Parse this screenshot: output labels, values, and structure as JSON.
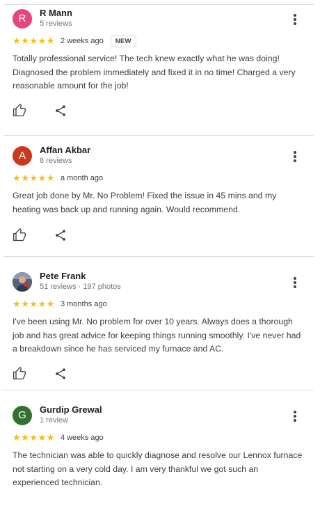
{
  "colors": {
    "star": "#fbbc04",
    "separator": "#dadce0",
    "avatar_r_mann": "#e8457a",
    "avatar_affan": "#c83b1d",
    "avatar_gurdip": "#34702f"
  },
  "icons": {
    "star": "★",
    "like": "thumb-up-icon",
    "share": "share-icon",
    "more": "more-vert-icon"
  },
  "reviews": [
    {
      "initial": "R",
      "name": "R Mann",
      "meta": "5 reviews",
      "rating": 5,
      "time": "2 weeks ago",
      "badge": "NEW",
      "text": "Totally professional service! The tech knew exactly what he was doing! Diagnosed the problem immediately and fixed it in no time! Charged a very reasonable amount for the job!"
    },
    {
      "initial": "A",
      "name": "Affan Akbar",
      "meta": "8 reviews",
      "rating": 5,
      "time": "a month ago",
      "text": "Great job done by Mr. No Problem! Fixed the issue in 45 mins and my heating was back up and running again. Would recommend."
    },
    {
      "initial": "",
      "name": "Pete Frank",
      "meta": "51 reviews · 197 photos",
      "rating": 5,
      "time": "3 months ago",
      "text": "I've been using Mr. No problem for over 10 years. Always does a thorough job and has great advice for keeping things running smoothly. I've never had a breakdown since he has serviced my furnace and AC."
    },
    {
      "initial": "G",
      "name": "Gurdip Grewal",
      "meta": "1 review",
      "rating": 5,
      "time": "4 weeks ago",
      "text": "The technician was able to quickly diagnose and resolve our Lennox furnace not starting on a very cold day. I am very thankful we got such an experienced technician."
    }
  ]
}
